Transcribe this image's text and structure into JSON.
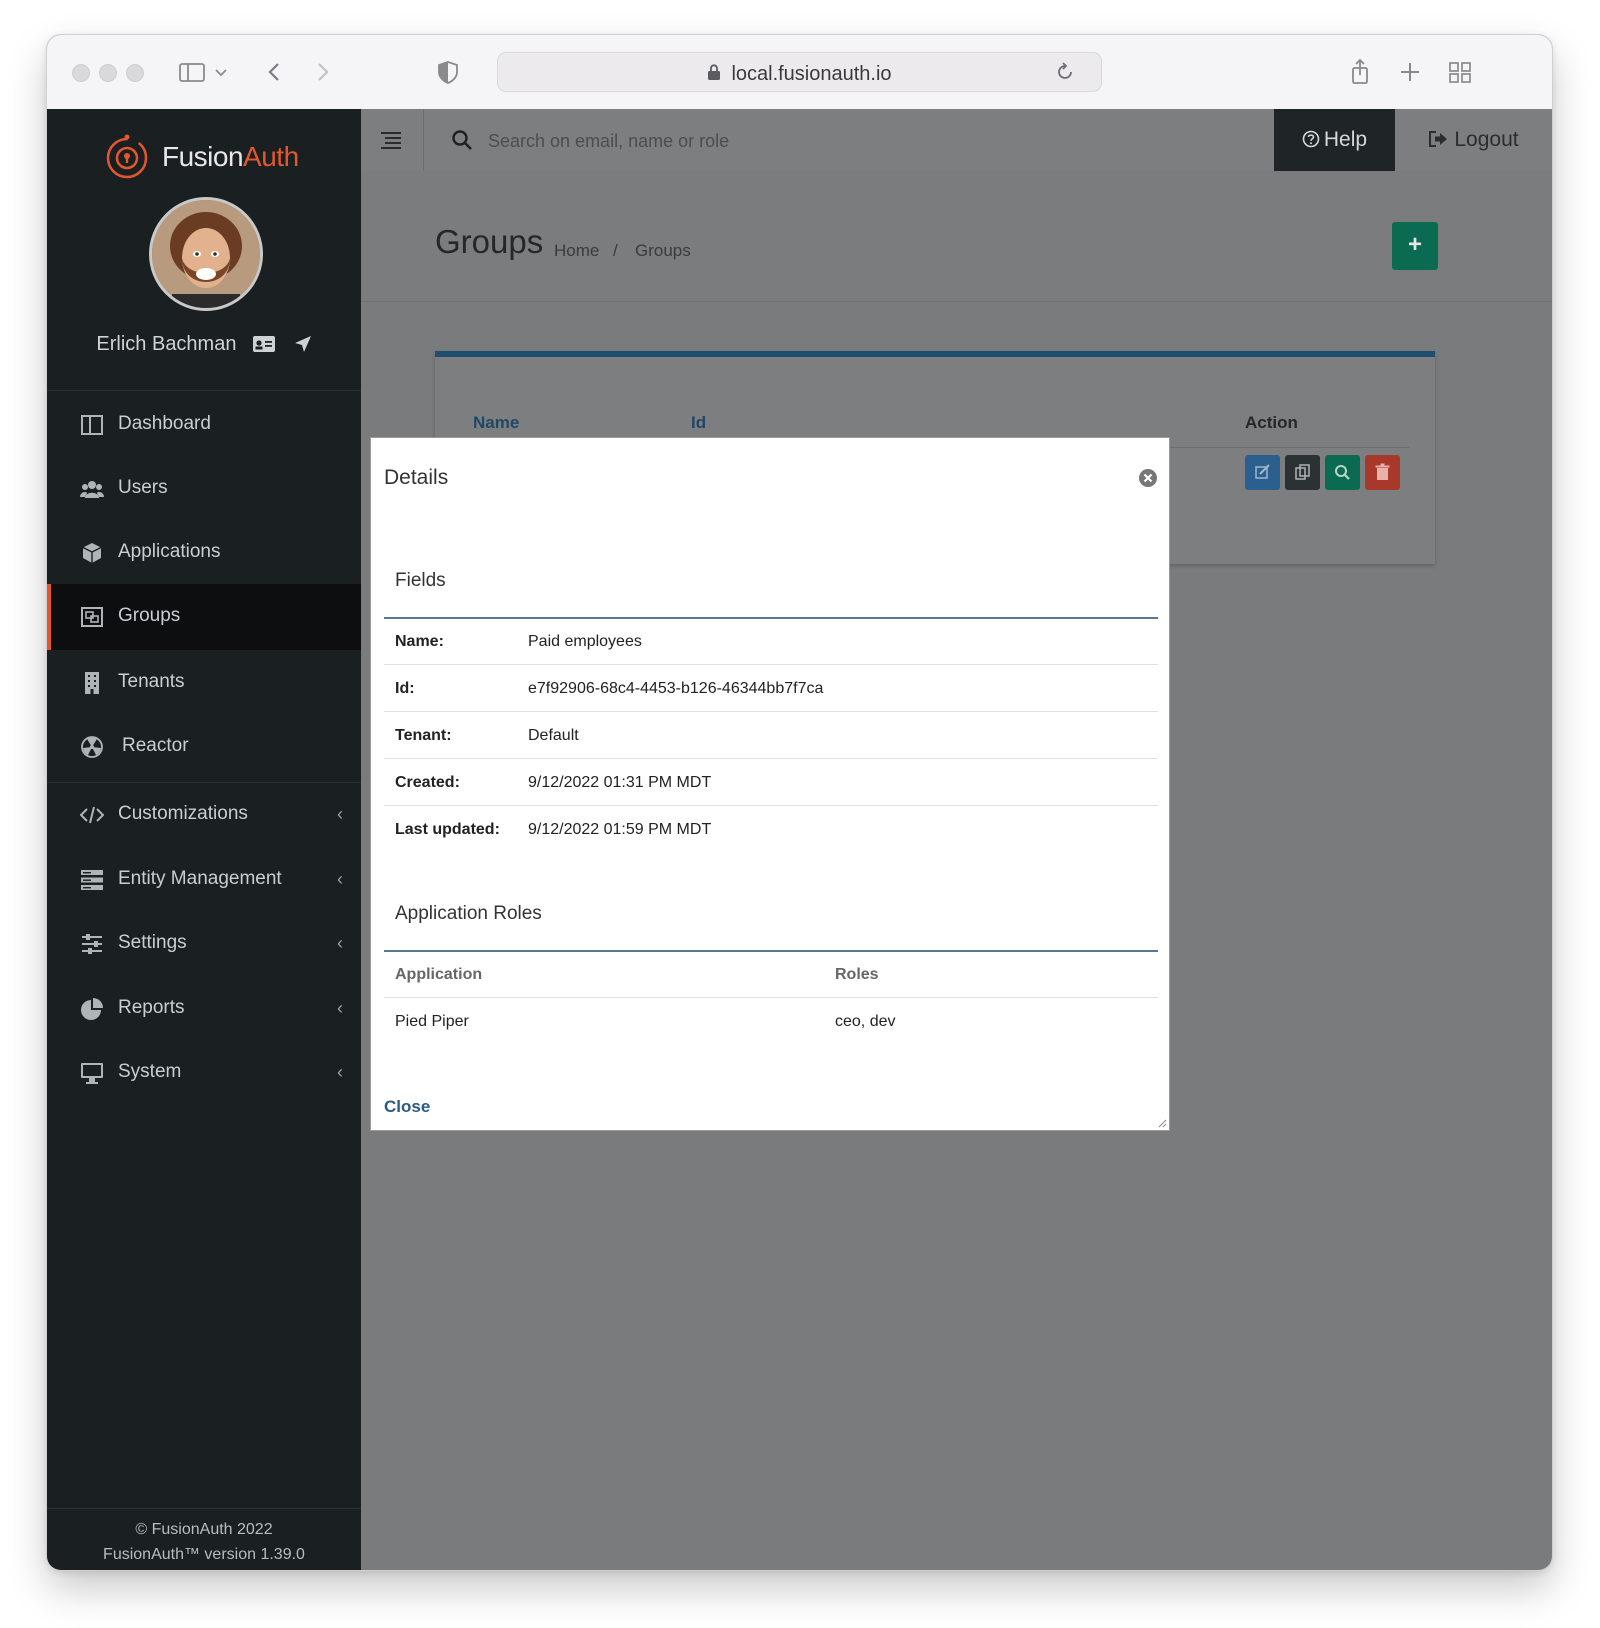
{
  "browser": {
    "url": "local.fusionauth.io"
  },
  "brand": {
    "name_part1": "Fusion",
    "name_part2": "Auth",
    "accent": "#e3572e"
  },
  "user": {
    "name": "Erlich Bachman"
  },
  "sidebar": {
    "items": [
      {
        "label": "Dashboard",
        "icon": "dashboard-icon"
      },
      {
        "label": "Users",
        "icon": "users-icon"
      },
      {
        "label": "Applications",
        "icon": "cube-icon"
      },
      {
        "label": "Groups",
        "icon": "groups-icon",
        "active": true
      },
      {
        "label": "Tenants",
        "icon": "building-icon"
      },
      {
        "label": "Reactor",
        "icon": "radiation-icon"
      },
      {
        "label": "Customizations",
        "icon": "code-icon",
        "expandable": true
      },
      {
        "label": "Entity Management",
        "icon": "server-icon",
        "expandable": true
      },
      {
        "label": "Settings",
        "icon": "sliders-icon",
        "expandable": true
      },
      {
        "label": "Reports",
        "icon": "pie-chart-icon",
        "expandable": true
      },
      {
        "label": "System",
        "icon": "desktop-icon",
        "expandable": true
      }
    ],
    "footer_line1": "© FusionAuth 2022",
    "footer_line2": "FusionAuth™ version 1.39.0"
  },
  "topbar": {
    "search_placeholder": "Search on email, name or role",
    "help_label": "Help",
    "logout_label": "Logout"
  },
  "page": {
    "title": "Groups",
    "breadcrumb": [
      "Home",
      "/",
      "Groups"
    ],
    "add_button": "+",
    "table_headers": {
      "name": "Name",
      "id": "Id",
      "action": "Action"
    },
    "action_colors": {
      "edit": "#2a5f8f",
      "copy": "#2c3134",
      "view": "#0b6b52",
      "delete": "#a8392a"
    }
  },
  "modal": {
    "title": "Details",
    "fields_title": "Fields",
    "fields": [
      {
        "label": "Name:",
        "value": "Paid employees"
      },
      {
        "label": "Id:",
        "value": "e7f92906-68c4-4453-b126-46344bb7f7ca"
      },
      {
        "label": "Tenant:",
        "value": "Default"
      },
      {
        "label": "Created:",
        "value": "9/12/2022 01:31 PM MDT"
      },
      {
        "label": "Last updated:",
        "value": "9/12/2022 01:59 PM MDT"
      }
    ],
    "roles_title": "Application Roles",
    "roles_headers": {
      "application": "Application",
      "roles": "Roles"
    },
    "roles_rows": [
      {
        "application": "Pied Piper",
        "roles": "ceo, dev"
      }
    ],
    "close_label": "Close"
  }
}
